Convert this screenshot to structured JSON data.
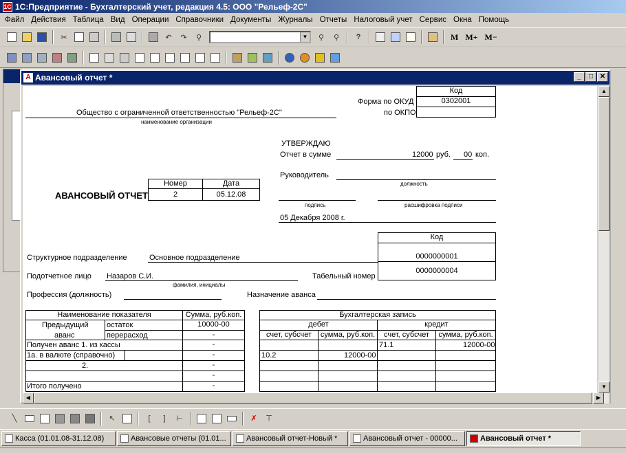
{
  "window": {
    "title": "1С:Предприятие - Бухгалтерский учет, редакция 4.5: ООО \"Рельеф-2С\""
  },
  "menu": [
    "Файл",
    "Действия",
    "Таблица",
    "Вид",
    "Операции",
    "Справочники",
    "Документы",
    "Журналы",
    "Отчеты",
    "Налоговый учет",
    "Сервис",
    "Окна",
    "Помощь"
  ],
  "toolbar": {
    "m": "М",
    "m_plus": "М+",
    "m_minus": "М−"
  },
  "document": {
    "title": "Авансовый отчет  *",
    "code_header": "Код",
    "okud_label": "Форма по ОКУД",
    "okud_value": "0302001",
    "okpo_label": "по ОКПО",
    "org_name": "Общество с ограниченной ответственностью \"Рельеф-2С\"",
    "org_caption": "наименование организации",
    "approve": "УТВЕРЖДАЮ",
    "report_sum_label": "Отчет в сумме",
    "report_sum_value": "12000",
    "rub": "руб.",
    "kop_value": "00",
    "kop": "коп.",
    "head_label": "Руководитель",
    "position_caption": "должность",
    "signature_caption": "подпись",
    "signature_decode_caption": "расшифровка подписи",
    "approve_date": "05 Декабря 2008 г.",
    "report_title": "АВАНСОВЫЙ ОТЧЕТ",
    "number_header": "Номер",
    "date_header": "Дата",
    "number_value": "2",
    "date_value": "05.12.08",
    "code_header2": "Код",
    "division_label": "Структурное подразделение",
    "division_value": "Основное подразделение",
    "division_code": "0000000001",
    "person_label": "Подотчетное лицо",
    "person_value": "Назаров С.И.",
    "person_caption": "фамилия, инициалы",
    "tab_number_label": "Табельный номер",
    "tab_number_value": "0000000004",
    "profession_label": "Профессия (должность)",
    "purpose_label": "Назначение аванса",
    "left_table": {
      "h1": "Наименование показателя",
      "h2": "Сумма, руб.коп.",
      "prev": "Предыдущий",
      "advance": "аванс",
      "remainder": "остаток",
      "overspend": "перерасход",
      "remainder_sum": "10000-00",
      "overspend_sum": "-",
      "row1": "Получен аванс 1. из кассы",
      "row1_sum": "-",
      "row1a": "1а. в валюте (справочно)",
      "row1a_sum": "-",
      "row2": "2.",
      "row2_sum": "-",
      "row3_sum": "-",
      "total": "Итого получено",
      "total_sum": "-"
    },
    "right_table": {
      "h": "Бухгалтерская запись",
      "debit": "дебет",
      "credit": "кредит",
      "acc": "счет, субсчет",
      "sum": "сумма, руб.коп.",
      "r1_credit_acc": "71.1",
      "r1_credit_sum": "12000-00",
      "r2_debit_acc": "10.2",
      "r2_debit_sum": "12000-00"
    }
  },
  "taskbar": [
    "Касса (01.01.08-31.12.08)",
    "Авансовые отчеты (01.01...",
    "Авансовый отчет-Новый *",
    "Авансовый отчет - 00000...",
    "Авансовый отчет  *"
  ]
}
